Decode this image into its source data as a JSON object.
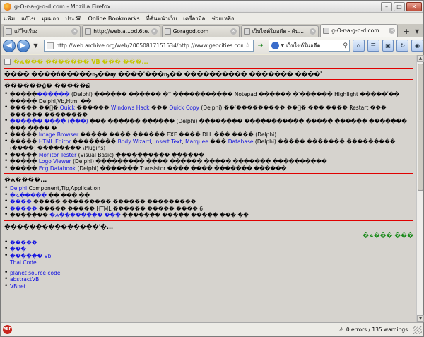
{
  "window": {
    "title": "g-O-r-a-g-o-d.com - Mozilla Firefox"
  },
  "menu": [
    "แฟ้ม",
    "แก้ไข",
    "มุมมอง",
    "ประวัติ",
    "Online Bookmarks",
    "ที่คั่นหน้าเว็บ",
    "เครื่องมือ",
    "ช่วยเหลือ"
  ],
  "tabs": [
    {
      "label": "แก้ไขเรื่อง",
      "active": false
    },
    {
      "label": "http://web.a...od.6te.net/",
      "active": false
    },
    {
      "label": "Goragod.com",
      "active": false
    },
    {
      "label": "เว็บไซต์ในอดีต - ค้น...",
      "active": false
    },
    {
      "label": "g-O-r-a-g-o-d.com",
      "active": true
    }
  ],
  "nav": {
    "url": "http://web.archive.org/web/20050817151534/http://www.geocities.com/gorag",
    "search_engine": "เว็บไซต์ในอดีต"
  },
  "page": {
    "header_link": "�ѧ��� ������� VB ��� ���...",
    "intro": "���� ����ô�����ҧ��ѹ ����ʹ���ҧ�� ���������� ������� ����ٴ",
    "sec1_title": "������ǵ� �����ӹ",
    "sec1_items": [
      {
        "pre": "�����",
        "link": "������",
        "post": " (Delphi) ������ ������ �'ʾ ����������� Notepad ������ �ʾ������ Highlight �����ʹ�� ����� Delphi,Vb,Html ��"
      },
      {
        "pre": "����� ��ͧ� ",
        "link": "Quick",
        "mid": " ������ ",
        "link2": "Windows Hack",
        "mid2": " ��� ",
        "link3": "Quick Copy",
        "post": " (Delphi) ��ʹ��������� ��ͧ� ��� ���� Restart ��� ������ ��������"
      },
      {
        "pre": "",
        "link": "������ ���� (���)",
        "post": " ��� ������ ������ (Delphi) �������� ����������� ����� ������ ������� ��� ���� �"
      },
      {
        "pre": "����� ",
        "link": "Image Browser",
        "post": " ����� ���� ������ EXE ���� DLL ��� ���� (Delphi)"
      },
      {
        "pre": "����� ",
        "link": "HTML Editor",
        "mid": " �������� ",
        "link2": "Body Wizard",
        "mid2": ", ",
        "link3": "Insert Text",
        "mid3": ", ",
        "link4": "Marquee",
        "mid4": " ��� ",
        "link5": "Database",
        "post": " (Delphi) ����� ������� ��������� (����) �������� \\Plugins)"
      },
      {
        "pre": "����� ",
        "link": "Monitor Tester",
        "post": " (Visual Basic) ���������� ������"
      },
      {
        "pre": "����� ",
        "link": "Logo Viewer",
        "post": " (Delphi) ��������� ���� ������ ����� ������� ����������"
      },
      {
        "pre": "����� ",
        "link": "Ecg Databook",
        "post": " (Delphi) ������� Transistor ���� ���� ������� ������"
      }
    ],
    "sec2_title": "�ѧ����...",
    "sec2_items": [
      {
        "link": "Delphi",
        "post": " Component,Tip,Application"
      },
      {
        "link": "�ѧ�����",
        "post": " �� ��� ��"
      },
      {
        "link": "����",
        "post": " ����� ��������� ������ ���������"
      },
      {
        "link": "�����",
        "post": " ����� ����� HTML ������ ����� ���� 6"
      },
      {
        "link": "�ѧ�������� ���",
        "pre": "������� ",
        "post": " ������� ����� ����� ��� ��"
      }
    ],
    "sec3_title": "���������������ʹ�...",
    "sec3_rlink": "�ѧ��� ���",
    "sec3_list1": [
      "�����",
      "���",
      "������ Vb",
      "Thai Code"
    ],
    "sec3_list2": [
      "planet source code",
      "abstractVB",
      "VBnet"
    ]
  },
  "status": {
    "warnings": "0 errors / 135 warnings"
  }
}
